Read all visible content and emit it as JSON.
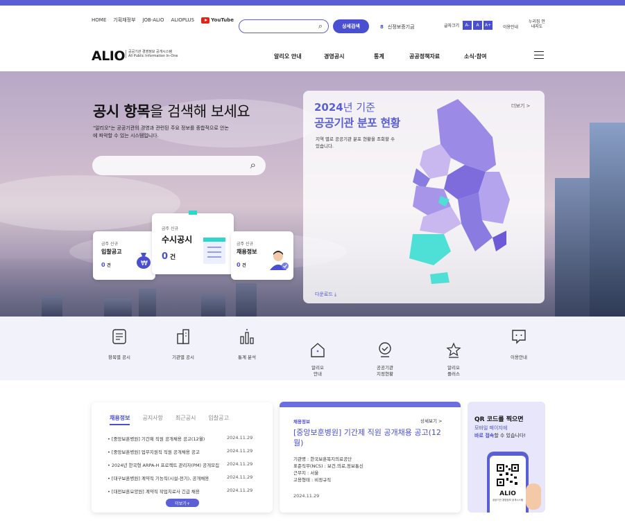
{
  "util": {
    "links": [
      "HOME",
      "기획재정부",
      "JOB-ALIO",
      "ALIOPLUS"
    ],
    "youtube": "YouTube",
    "search_placeholder": "",
    "adv_search": "상세검색",
    "new_inst_count": "8",
    "new_inst_label": "신정보증기금",
    "font_label": "글자크기",
    "font_buttons": [
      "A-",
      "A",
      "A+"
    ],
    "guide": "이용안내",
    "nuri": "누리집 안내지도"
  },
  "logo": {
    "name": "ALIO",
    "sub1": "공공기관 경영정보 공개시스템",
    "sub2": "All Public Information In-One"
  },
  "gnb": [
    "알리오 안내",
    "경영공시",
    "통계",
    "공공정책자료",
    "소식·참여"
  ],
  "hero": {
    "title_bold": "공시 항목",
    "title_rest": "을 검색해 보세요",
    "desc": "\"알리오\"는 공공기관의 경영과 관련된 주요 정보를 종합적으로 안논에 파악할 수 있는 시스템입니다."
  },
  "cards": [
    {
      "kicker": "금주 신규",
      "title": "입찰공고",
      "count": "0",
      "unit": "건"
    },
    {
      "kicker": "금주 신규",
      "title": "수시공시",
      "count": "0",
      "unit": "건"
    },
    {
      "kicker": "금주 신규",
      "title": "채용정보",
      "count": "0",
      "unit": "건"
    }
  ],
  "map": {
    "year": "2024",
    "year_suffix": "년 기준",
    "title": "공공기관 분포 현황",
    "desc": "지역 별로 공공기관 분포 현황을 조회할 수 있습니다.",
    "more": "더보기 >",
    "download": "다운로드"
  },
  "quick": [
    {
      "label": "항목별 공시",
      "icon": "list-doc-icon"
    },
    {
      "label": "기관별 공시",
      "icon": "building-icon"
    },
    {
      "label": "통계 분석",
      "icon": "chart-icon"
    },
    {
      "label": "알리오\n안내",
      "icon": "home-icon"
    },
    {
      "label": "공공기관\n지정현황",
      "icon": "map-pin-icon"
    },
    {
      "label": "알리오\n플러스",
      "icon": "star-icon"
    },
    {
      "label": "이용안내",
      "icon": "chat-icon"
    }
  ],
  "news": {
    "tabs": [
      "채용정보",
      "공지사항",
      "최근공시",
      "입찰공고"
    ],
    "rows": [
      {
        "title": "[중앙보훈병원] 기간제 직원 공개채용 공고(12월)",
        "date": "2024.11.29"
      },
      {
        "title": "[중앙보훈병원] 업무지원직 직원 공개채용 공고",
        "date": "2024.11.29"
      },
      {
        "title": "2024년 한국형 ARPA-H 프로젝트 관리자(PM) 공개모집",
        "date": "2024.11.29"
      },
      {
        "title": "[대구보훈병원] 계약직 기능직(시설-전기), 공개채용",
        "date": "2024.11.29"
      },
      {
        "title": "[대전보훈요양원] 계약직 작업치료사 긴급 채용",
        "date": "2024.11.29"
      }
    ],
    "more": "더보기+"
  },
  "job": {
    "kicker": "채용정보",
    "more": "상세보기 >",
    "title": "[중앙보훈병원] 기간제 직원 공개채용 공고(12월)",
    "org": "기관명 : 한국보훈복지의료공단",
    "ncs": "표준직무(NCS) : 보건.의료,정보통신",
    "place": "근무지 : 서울",
    "type": "고용형태 : 비정규직",
    "date": "2024.11.29"
  },
  "qr": {
    "title": "QR 코드를 찍으면",
    "line1": "모바일 페이지에",
    "line2_hl": "바로 접속",
    "line2_rest": "할 수 있습니다!",
    "phone_logo": "ALIO",
    "phone_sub": "공공기관 경영정보 공개시스템"
  },
  "colors": {
    "accent": "#5b5fd6",
    "map_light": "#c9b8f0",
    "map_mid": "#9b8ae6",
    "map_teal": "#4ee0d6"
  }
}
